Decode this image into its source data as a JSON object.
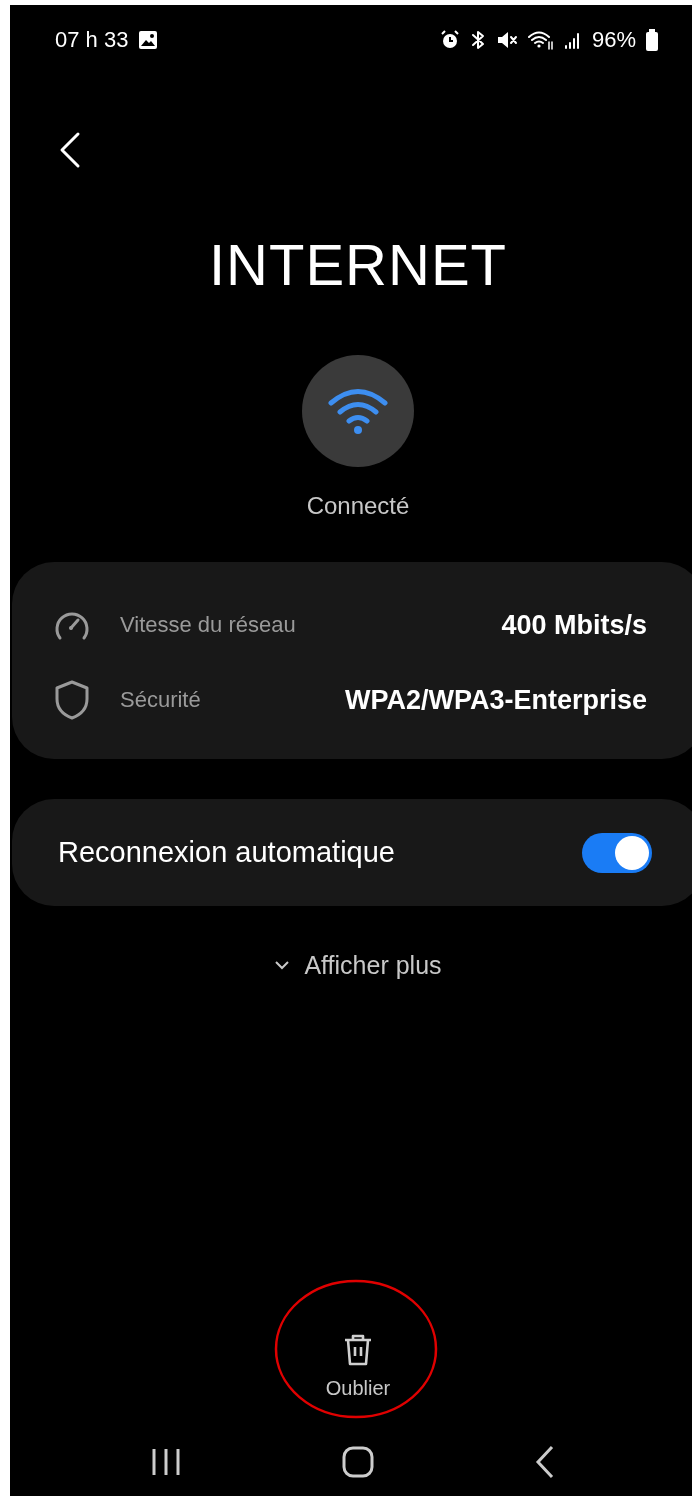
{
  "status_bar": {
    "time": "07 h 33",
    "battery": "96%"
  },
  "header": {
    "title": "INTERNET"
  },
  "connection": {
    "status": "Connecté"
  },
  "details": [
    {
      "kind": "speed",
      "label": "Vitesse du réseau",
      "value": "400 Mbits/s"
    },
    {
      "kind": "security",
      "label": "Sécurité",
      "value": "WPA2/WPA3-Enterprise"
    }
  ],
  "auto_reconnect": {
    "label": "Reconnexion automatique",
    "on": true
  },
  "show_more": {
    "label": "Afficher plus"
  },
  "forget_button": {
    "label": "Oublier",
    "highlighted": true
  }
}
